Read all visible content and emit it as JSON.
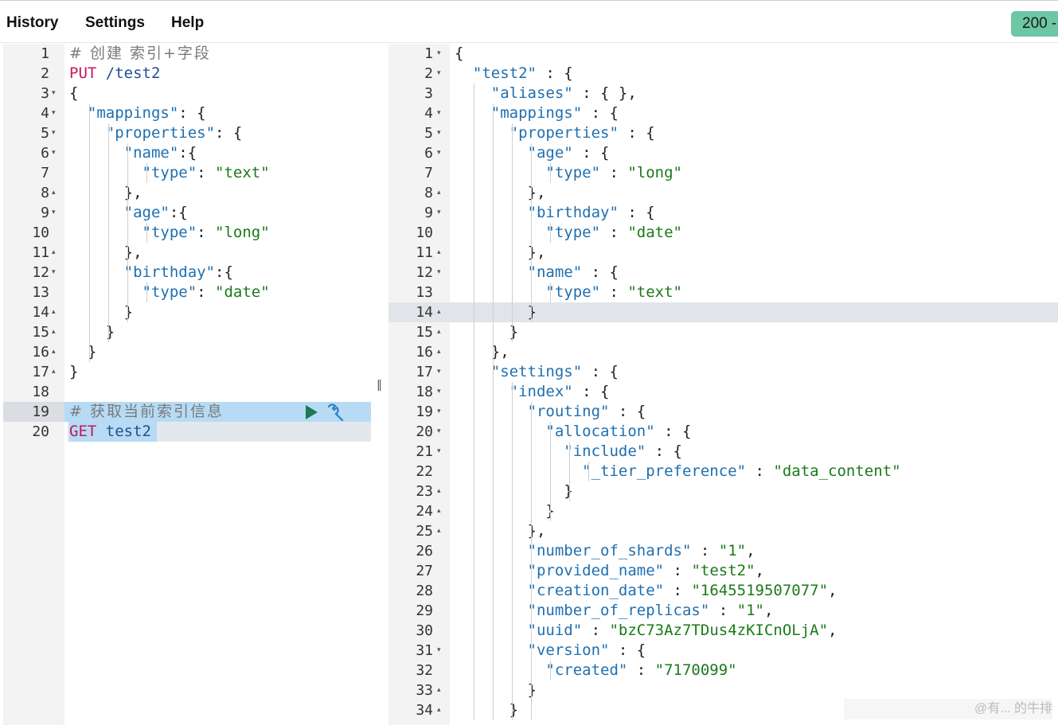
{
  "menu": {
    "history": "History",
    "settings": "Settings",
    "help": "Help"
  },
  "status": {
    "code": "200 -"
  },
  "request_lines": [
    [
      [
        "c",
        "# 创建 索引+字段"
      ]
    ],
    [
      [
        "m",
        "PUT"
      ],
      [
        "u",
        " /test2"
      ]
    ],
    [
      [
        "p",
        "{"
      ]
    ],
    [
      [
        "p",
        "  "
      ],
      [
        "k",
        "\"mappings\""
      ],
      [
        "p",
        ": {"
      ]
    ],
    [
      [
        "p",
        "    "
      ],
      [
        "k",
        "\"properties\""
      ],
      [
        "p",
        ": {"
      ]
    ],
    [
      [
        "p",
        "      "
      ],
      [
        "k",
        "\"name\""
      ],
      [
        "p",
        ":{"
      ]
    ],
    [
      [
        "p",
        "        "
      ],
      [
        "k",
        "\"type\""
      ],
      [
        "p",
        ": "
      ],
      [
        "s",
        "\"text\""
      ]
    ],
    [
      [
        "p",
        "      },"
      ]
    ],
    [
      [
        "p",
        "      "
      ],
      [
        "k",
        "\"age\""
      ],
      [
        "p",
        ":{"
      ]
    ],
    [
      [
        "p",
        "        "
      ],
      [
        "k",
        "\"type\""
      ],
      [
        "p",
        ": "
      ],
      [
        "s",
        "\"long\""
      ]
    ],
    [
      [
        "p",
        "      },"
      ]
    ],
    [
      [
        "p",
        "      "
      ],
      [
        "k",
        "\"birthday\""
      ],
      [
        "p",
        ":{"
      ]
    ],
    [
      [
        "p",
        "        "
      ],
      [
        "k",
        "\"type\""
      ],
      [
        "p",
        ": "
      ],
      [
        "s",
        "\"date\""
      ]
    ],
    [
      [
        "p",
        "      }"
      ]
    ],
    [
      [
        "p",
        "    }"
      ]
    ],
    [
      [
        "p",
        "  }"
      ]
    ],
    [
      [
        "p",
        "}"
      ]
    ],
    [
      [
        "p",
        ""
      ]
    ],
    [
      [
        "c",
        "# 获取当前索引信息"
      ]
    ],
    [
      [
        "m",
        "GET"
      ],
      [
        "u",
        " test2"
      ]
    ]
  ],
  "request_folds": [
    "",
    "",
    "▾",
    "▾",
    "▾",
    "▾",
    "",
    "▴",
    "▾",
    "",
    "▴",
    "▾",
    "",
    "▴",
    "▴",
    "▴",
    "▴",
    "",
    "",
    ""
  ],
  "response_lines": [
    [
      [
        "p",
        "{"
      ]
    ],
    [
      [
        "p",
        "  "
      ],
      [
        "k",
        "\"test2\""
      ],
      [
        "p",
        " : {"
      ]
    ],
    [
      [
        "p",
        "    "
      ],
      [
        "k",
        "\"aliases\""
      ],
      [
        "p",
        " : { },"
      ]
    ],
    [
      [
        "p",
        "    "
      ],
      [
        "k",
        "\"mappings\""
      ],
      [
        "p",
        " : {"
      ]
    ],
    [
      [
        "p",
        "      "
      ],
      [
        "k",
        "\"properties\""
      ],
      [
        "p",
        " : {"
      ]
    ],
    [
      [
        "p",
        "        "
      ],
      [
        "k",
        "\"age\""
      ],
      [
        "p",
        " : {"
      ]
    ],
    [
      [
        "p",
        "          "
      ],
      [
        "k",
        "\"type\""
      ],
      [
        "p",
        " : "
      ],
      [
        "s",
        "\"long\""
      ]
    ],
    [
      [
        "p",
        "        },"
      ]
    ],
    [
      [
        "p",
        "        "
      ],
      [
        "k",
        "\"birthday\""
      ],
      [
        "p",
        " : {"
      ]
    ],
    [
      [
        "p",
        "          "
      ],
      [
        "k",
        "\"type\""
      ],
      [
        "p",
        " : "
      ],
      [
        "s",
        "\"date\""
      ]
    ],
    [
      [
        "p",
        "        },"
      ]
    ],
    [
      [
        "p",
        "        "
      ],
      [
        "k",
        "\"name\""
      ],
      [
        "p",
        " : {"
      ]
    ],
    [
      [
        "p",
        "          "
      ],
      [
        "k",
        "\"type\""
      ],
      [
        "p",
        " : "
      ],
      [
        "s",
        "\"text\""
      ]
    ],
    [
      [
        "p",
        "        }"
      ]
    ],
    [
      [
        "p",
        "      }"
      ]
    ],
    [
      [
        "p",
        "    },"
      ]
    ],
    [
      [
        "p",
        "    "
      ],
      [
        "k",
        "\"settings\""
      ],
      [
        "p",
        " : {"
      ]
    ],
    [
      [
        "p",
        "      "
      ],
      [
        "k",
        "\"index\""
      ],
      [
        "p",
        " : {"
      ]
    ],
    [
      [
        "p",
        "        "
      ],
      [
        "k",
        "\"routing\""
      ],
      [
        "p",
        " : {"
      ]
    ],
    [
      [
        "p",
        "          "
      ],
      [
        "k",
        "\"allocation\""
      ],
      [
        "p",
        " : {"
      ]
    ],
    [
      [
        "p",
        "            "
      ],
      [
        "k",
        "\"include\""
      ],
      [
        "p",
        " : {"
      ]
    ],
    [
      [
        "p",
        "              "
      ],
      [
        "k",
        "\"_tier_preference\""
      ],
      [
        "p",
        " : "
      ],
      [
        "s",
        "\"data_content\""
      ]
    ],
    [
      [
        "p",
        "            }"
      ]
    ],
    [
      [
        "p",
        "          }"
      ]
    ],
    [
      [
        "p",
        "        },"
      ]
    ],
    [
      [
        "p",
        "        "
      ],
      [
        "k",
        "\"number_of_shards\""
      ],
      [
        "p",
        " : "
      ],
      [
        "s",
        "\"1\""
      ],
      [
        "p",
        ","
      ]
    ],
    [
      [
        "p",
        "        "
      ],
      [
        "k",
        "\"provided_name\""
      ],
      [
        "p",
        " : "
      ],
      [
        "s",
        "\"test2\""
      ],
      [
        "p",
        ","
      ]
    ],
    [
      [
        "p",
        "        "
      ],
      [
        "k",
        "\"creation_date\""
      ],
      [
        "p",
        " : "
      ],
      [
        "s",
        "\"1645519507077\""
      ],
      [
        "p",
        ","
      ]
    ],
    [
      [
        "p",
        "        "
      ],
      [
        "k",
        "\"number_of_replicas\""
      ],
      [
        "p",
        " : "
      ],
      [
        "s",
        "\"1\""
      ],
      [
        "p",
        ","
      ]
    ],
    [
      [
        "p",
        "        "
      ],
      [
        "k",
        "\"uuid\""
      ],
      [
        "p",
        " : "
      ],
      [
        "s",
        "\"bzC73Az7TDus4zKICnOLjA\""
      ],
      [
        "p",
        ","
      ]
    ],
    [
      [
        "p",
        "        "
      ],
      [
        "k",
        "\"version\""
      ],
      [
        "p",
        " : {"
      ]
    ],
    [
      [
        "p",
        "          "
      ],
      [
        "k",
        "\"created\""
      ],
      [
        "p",
        " : "
      ],
      [
        "s",
        "\"7170099\""
      ]
    ],
    [
      [
        "p",
        "        }"
      ]
    ],
    [
      [
        "p",
        "      }"
      ]
    ]
  ],
  "response_folds": [
    "▾",
    "▾",
    "",
    "▾",
    "▾",
    "▾",
    "",
    "▴",
    "▾",
    "",
    "▴",
    "▾",
    "",
    "▴",
    "▴",
    "▴",
    "▾",
    "▾",
    "▾",
    "▾",
    "▾",
    "",
    "▴",
    "▴",
    "▴",
    "",
    "",
    "",
    "",
    "",
    "▾",
    "",
    "▴",
    "▴"
  ],
  "watermark": "@有... 的牛排"
}
